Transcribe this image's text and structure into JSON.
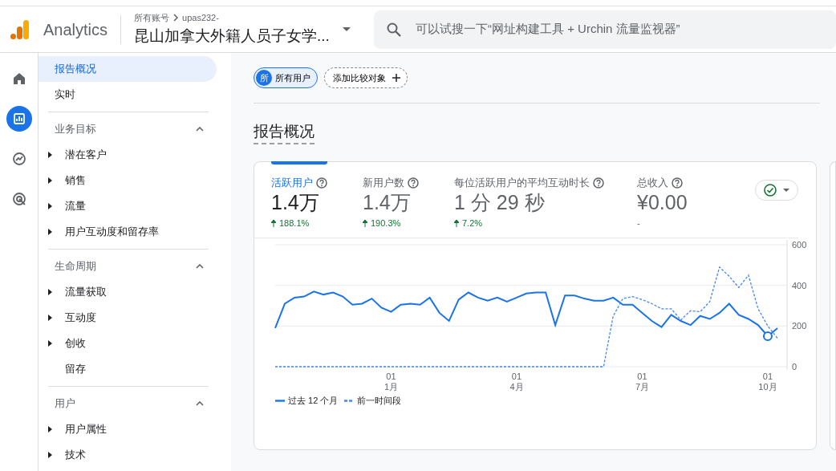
{
  "header": {
    "product": "Analytics",
    "breadcrumb": [
      "所有账号",
      "upas232-"
    ],
    "property": "昆山加拿大外籍人员子女学...",
    "search": {
      "placeholder": "可以试搜一下“网址构建工具 + Urchin 流量监视器”"
    }
  },
  "rail": [
    {
      "kind": "home",
      "selected": false
    },
    {
      "kind": "reports",
      "selected": true
    },
    {
      "kind": "explore",
      "selected": false
    },
    {
      "kind": "advertising",
      "selected": false
    }
  ],
  "nav": {
    "items": [
      {
        "label": "报告概况",
        "selected": true
      },
      {
        "label": "实时",
        "selected": false
      }
    ],
    "sections": [
      {
        "title": "业务目标",
        "expanded": true,
        "items": [
          {
            "label": "潜在客户",
            "kind": "group"
          },
          {
            "label": "销售",
            "kind": "group"
          },
          {
            "label": "流量",
            "kind": "group"
          },
          {
            "label": "用户互动度和留存率",
            "kind": "group"
          }
        ]
      },
      {
        "title": "生命周期",
        "expanded": true,
        "items": [
          {
            "label": "流量获取",
            "kind": "group"
          },
          {
            "label": "互动度",
            "kind": "group"
          },
          {
            "label": "创收",
            "kind": "group"
          },
          {
            "label": "留存",
            "kind": "leaf"
          }
        ]
      },
      {
        "title": "用户",
        "expanded": true,
        "items": [
          {
            "label": "用户属性",
            "kind": "group"
          },
          {
            "label": "技术",
            "kind": "group"
          }
        ]
      }
    ]
  },
  "chips": [
    {
      "kind": "segment",
      "avatar": "所",
      "label": "所有用户"
    },
    {
      "kind": "add",
      "label": "添加比较对象"
    }
  ],
  "title": "报告概况",
  "metrics": [
    {
      "label": "活跃用户",
      "value": "1.4万",
      "change": "188.1%",
      "rising": true,
      "selected": true
    },
    {
      "label": "新用户数",
      "value": "1.4万",
      "change": "190.3%",
      "rising": true,
      "selected": false
    },
    {
      "label": "每位活跃用户的平均互动时长",
      "value": "1 分 29 秒",
      "change": "7.2%",
      "rising": true,
      "selected": false
    },
    {
      "label": "总收入",
      "value": "¥0.00",
      "change": "-",
      "rising": false,
      "selected": false
    }
  ],
  "chart_data": {
    "type": "line",
    "categories": [
      null,
      null,
      null,
      null,
      null,
      null,
      null,
      null,
      null,
      null,
      null,
      null,
      "01 1月",
      null,
      null,
      null,
      null,
      null,
      null,
      null,
      null,
      null,
      null,
      null,
      null,
      "01 4月",
      null,
      null,
      null,
      null,
      null,
      null,
      null,
      null,
      null,
      null,
      null,
      null,
      "01 7月",
      null,
      null,
      null,
      null,
      null,
      null,
      null,
      null,
      null,
      null,
      null,
      null,
      "01 10月",
      null
    ],
    "ylim": [
      0,
      600
    ],
    "yticks": [
      0,
      200,
      400,
      600
    ],
    "series": [
      {
        "name": "过去 12 个月",
        "color": "#1a73e8",
        "line_style": "solid",
        "values": [
          190,
          310,
          340,
          345,
          370,
          355,
          365,
          345,
          305,
          310,
          335,
          290,
          270,
          305,
          310,
          305,
          340,
          265,
          225,
          330,
          365,
          340,
          325,
          340,
          320,
          340,
          360,
          365,
          365,
          205,
          350,
          350,
          335,
          325,
          325,
          340,
          305,
          305,
          265,
          225,
          195,
          255,
          225,
          205,
          250,
          235,
          265,
          310,
          255,
          235,
          205,
          150,
          190
        ]
      },
      {
        "name": "前一时间段",
        "color": "#4285f4",
        "line_style": "dashed",
        "values": [
          0,
          0,
          0,
          0,
          0,
          0,
          0,
          0,
          0,
          0,
          0,
          0,
          0,
          0,
          0,
          0,
          0,
          0,
          0,
          0,
          0,
          0,
          0,
          0,
          0,
          0,
          0,
          0,
          0,
          0,
          0,
          0,
          0,
          0,
          0,
          250,
          335,
          345,
          330,
          310,
          285,
          285,
          230,
          275,
          270,
          320,
          490,
          445,
          390,
          450,
          285,
          200,
          140
        ]
      }
    ]
  }
}
